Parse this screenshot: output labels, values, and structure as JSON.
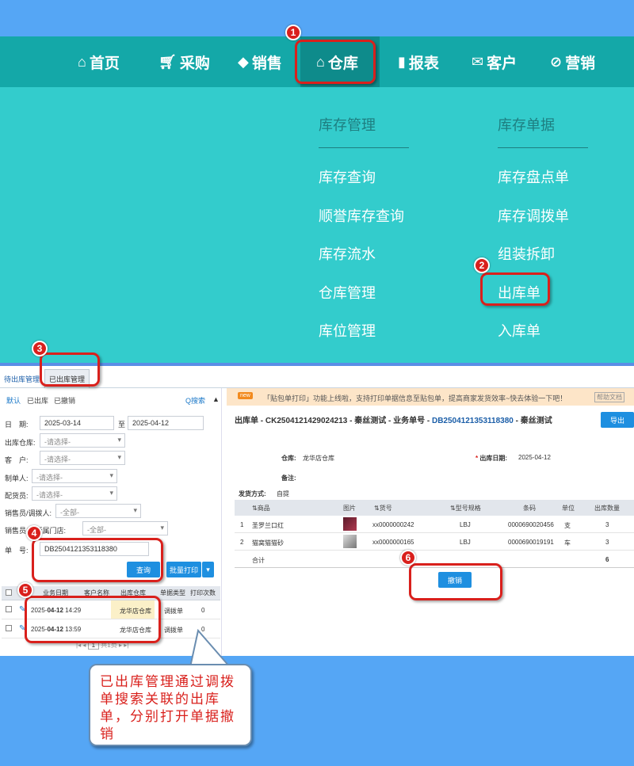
{
  "nav": {
    "items": [
      {
        "label": "首页",
        "icon": "home-icon"
      },
      {
        "label": "采购",
        "icon": "cart-icon"
      },
      {
        "label": "销售",
        "icon": "tag-icon"
      },
      {
        "label": "仓库",
        "icon": "warehouse-icon"
      },
      {
        "label": "报表",
        "icon": "clipboard-icon"
      },
      {
        "label": "客户",
        "icon": "mail-icon"
      },
      {
        "label": "营销",
        "icon": "discount-tag-icon"
      }
    ]
  },
  "dropdown": {
    "col1": {
      "heading": "库存管理",
      "items": [
        "库存查询",
        "顺誉库存查询",
        "库存流水",
        "仓库管理",
        "库位管理"
      ]
    },
    "col2": {
      "heading": "库存单据",
      "items": [
        "库存盘点单",
        "库存调拨单",
        "组装拆卸",
        "出库单",
        "入库单"
      ]
    }
  },
  "badges": [
    "1",
    "2",
    "3",
    "4",
    "5",
    "6"
  ],
  "tabs": {
    "pending": "待出库管理",
    "done": "已出库管理"
  },
  "left": {
    "subtabs": [
      "默认",
      "已出库",
      "已撤销"
    ],
    "search": "Q搜索",
    "collapse": "▲",
    "date_label": "日　期:",
    "date_from": "2025-03-14",
    "date_to_label": "至",
    "date_to": "2025-04-12",
    "fields": [
      {
        "label": "出库仓库:",
        "value": "-请选择-"
      },
      {
        "label": "客　户:",
        "value": "-请选择-"
      },
      {
        "label": "制单人:",
        "value": "-请选择-"
      },
      {
        "label": "配货员:",
        "value": "-请选择-"
      },
      {
        "label": "销售员/调拨人:",
        "value": "-全部-"
      },
      {
        "label": "销售员/人所属门店:",
        "value": "-全部-"
      }
    ],
    "order_label": "单　号:",
    "order_value": "DB2504121353118380",
    "query_btn": "查询",
    "batch_btn": "批量打印",
    "grid_headers": [
      "业务日期",
      "客户名称",
      "出库仓库",
      "单据类型",
      "打印次数"
    ],
    "rows": [
      {
        "date": "2025-",
        "date_bold": "04-12",
        "time": "14:29",
        "warehouse": "龙华店仓库",
        "type": "调拨单",
        "count": "0"
      },
      {
        "date": "2025-",
        "date_bold": "04-12",
        "time": "13:59",
        "warehouse": "龙华店仓库",
        "type": "调拨单",
        "count": "0"
      }
    ],
    "pager": {
      "current": "1",
      "suffix": "共1页"
    }
  },
  "right": {
    "banner_badge": "new",
    "banner_text": "「贴包单打印」功能上线啦，支持打印单据信息至贴包单，提高商家发货效率~快去体验一下吧！",
    "banner_link": "帮助文档",
    "title_prefix": "出库单 - CK2504121429024213 - 秦丝测试 - 业务单号 - ",
    "title_link": "DB2504121353118380",
    "title_suffix": " - 秦丝测试",
    "export_btn": "导出",
    "warehouse_label": "仓库:",
    "warehouse_value": "龙华店仓库",
    "date_label": "出库日期:",
    "date_value": "2025-04-12",
    "remark_label": "备注:",
    "ship_label": "发货方式:",
    "ship_value": "自提",
    "table_headers": [
      "商品",
      "图片",
      "货号",
      "型号规格",
      "条码",
      "单位",
      "出库数量"
    ],
    "rows": [
      {
        "no": "1",
        "name": "圣罗兰口红",
        "sku": "xx0000000242",
        "spec": "LBJ",
        "barcode": "0000690020456",
        "unit": "支",
        "qty": "3"
      },
      {
        "no": "2",
        "name": "猫窝猫猫砂",
        "sku": "xx0000000165",
        "spec": "LBJ",
        "barcode": "0000690019191",
        "unit": "车",
        "qty": "3"
      }
    ],
    "total_label": "合计",
    "total_qty": "6",
    "cancel_btn": "撤销"
  },
  "callout": {
    "text": "已出库管理通过调拨单搜索关联的出库单，分别打开单据撤销"
  },
  "colors": {
    "nav": "#14a8a8",
    "dropdown": "#33cccc",
    "annotation": "#d9201c",
    "background": "#55a6f5"
  }
}
